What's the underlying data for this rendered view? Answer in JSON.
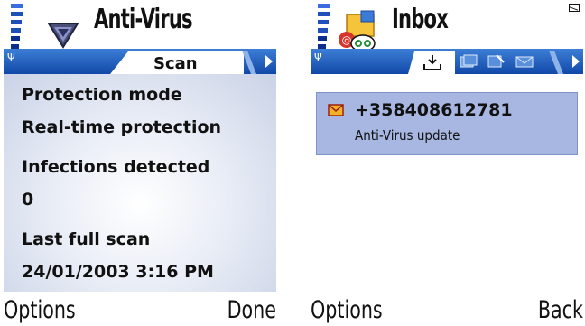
{
  "left_screen": {
    "title": "Anti-Virus",
    "active_tab": "Scan",
    "fields": [
      {
        "label": "Protection mode",
        "value": "Real-time protection"
      },
      {
        "label": "Infections detected",
        "value": "0"
      },
      {
        "label": "Last full scan",
        "value": "24/01/2003 3:16 PM"
      }
    ],
    "softkeys": {
      "left": "Options",
      "right": "Done"
    }
  },
  "right_screen": {
    "title": "Inbox",
    "messages": [
      {
        "sender": "+358408612781",
        "subject": "Anti-Virus update"
      }
    ],
    "softkeys": {
      "left": "Options",
      "right": "Back"
    }
  },
  "colors": {
    "tab_bar": "#1148a8",
    "selected_message": "#a7b7e2",
    "signal": "#1f4fb8"
  }
}
